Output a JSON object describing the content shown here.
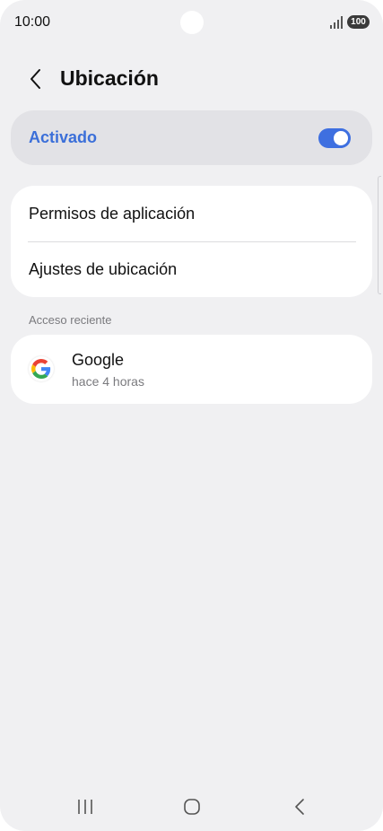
{
  "status_bar": {
    "time": "10:00",
    "battery": "100",
    "icons": [
      "signal-icon",
      "battery-icon"
    ]
  },
  "header": {
    "title": "Ubicación",
    "back_icon": "chevron-left-icon"
  },
  "location_toggle": {
    "label": "Activado",
    "on": true,
    "label_color": "#3b6fd9",
    "switch_color": "#3e6fe0"
  },
  "menu": {
    "items": [
      {
        "label": "Permisos de aplicación"
      },
      {
        "label": "Ajustes de ubicación"
      }
    ]
  },
  "recent_access": {
    "section_label": "Acceso reciente",
    "items": [
      {
        "app": "Google",
        "time": "hace 4 horas",
        "icon": "google-icon"
      }
    ]
  },
  "nav_bar": {
    "buttons": [
      "recents-icon",
      "home-icon",
      "back-icon"
    ]
  }
}
